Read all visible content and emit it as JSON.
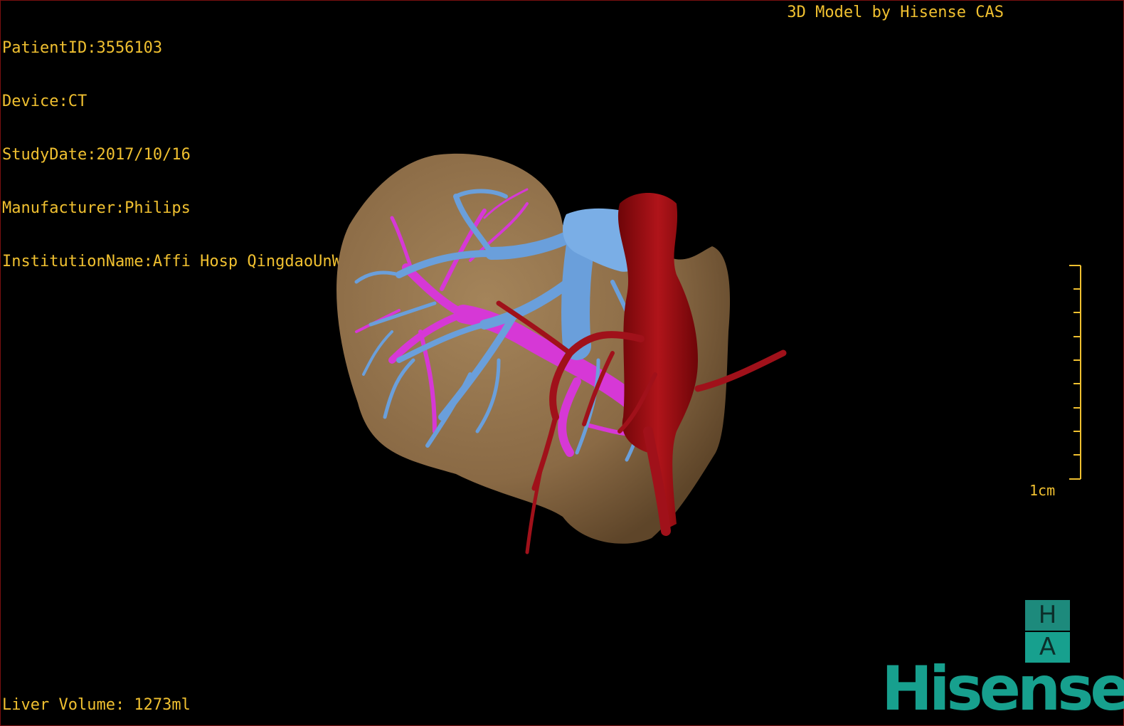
{
  "info": {
    "patient_id": "PatientID:3556103",
    "device": "Device:CT",
    "study_date": "StudyDate:2017/10/16",
    "manufacturer": "Manufacturer:Philips",
    "institution": "InstitutionName:Affi Hosp QingdaoUnW"
  },
  "header": {
    "brand_caption": "3D Model by Hisense CAS"
  },
  "footer": {
    "liver_volume": "Liver Volume: 1273ml"
  },
  "scale_bar": {
    "label": "1cm",
    "tick_count": 9
  },
  "logo": {
    "top_letter": "H",
    "bottom_letter": "A",
    "wordmark": "Hisense"
  },
  "colors": {
    "text": "#f0c030",
    "liver": "#8a6a45",
    "hepatic_vein": "#6a9fdb",
    "portal_vein": "#d638d6",
    "artery_vena_cava": "#9c0d10",
    "brand": "#17a08e"
  }
}
